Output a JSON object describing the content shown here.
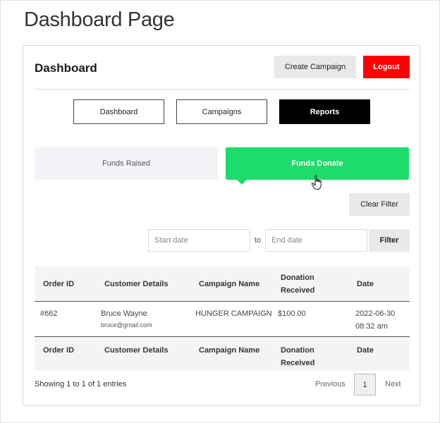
{
  "page": {
    "title": "Dashboard Page"
  },
  "card": {
    "title": "Dashboard",
    "create_campaign_label": "Create Campaign",
    "logout_label": "Logout"
  },
  "nav_tabs": [
    {
      "label": "Dashboard",
      "active": false
    },
    {
      "label": "Campaigns",
      "active": false
    },
    {
      "label": "Reports",
      "active": true
    }
  ],
  "fund_tabs": {
    "raised_label": "Funds Raised",
    "donate_label": "Funds Donate",
    "active": "donate"
  },
  "filters": {
    "clear_filter_label": "Clear Filter",
    "start_date_placeholder": "Start date",
    "to_label": "to",
    "end_date_placeholder": "End date",
    "filter_label": "Filter"
  },
  "table": {
    "headers": {
      "order_id": "Order ID",
      "customer": "Customer Details",
      "campaign": "Campaign Name",
      "donation": "Donation Received",
      "date": "Date"
    },
    "rows": [
      {
        "order_id": "#662",
        "customer_name": "Bruce Wayne",
        "customer_email": "bruce@gmail.com",
        "campaign": "HUNGER CAMPAIGN",
        "donation": "$100.00",
        "date": "2022-06-30 08:32 am"
      }
    ]
  },
  "pagination": {
    "showing": "Showing 1 to 1 of 1 entries",
    "previous": "Previous",
    "current_page": "1",
    "next": "Next"
  },
  "colors": {
    "logout": "#ff0000",
    "funds_donate": "#1edc6c",
    "reports_tab": "#000000"
  }
}
